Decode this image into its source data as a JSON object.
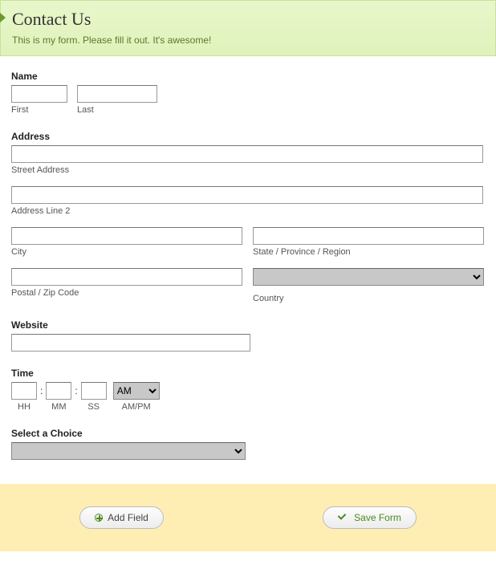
{
  "header": {
    "title": "Contact Us",
    "subtitle": "This is my form. Please fill it out. It's awesome!"
  },
  "name": {
    "label": "Name",
    "first_sub": "First",
    "last_sub": "Last",
    "first_val": "",
    "last_val": ""
  },
  "address": {
    "label": "Address",
    "street_sub": "Street Address",
    "street_val": "",
    "line2_sub": "Address Line 2",
    "line2_val": "",
    "city_sub": "City",
    "city_val": "",
    "state_sub": "State / Province / Region",
    "state_val": "",
    "postal_sub": "Postal / Zip Code",
    "postal_val": "",
    "country_sub": "Country",
    "country_val": ""
  },
  "website": {
    "label": "Website",
    "val": ""
  },
  "time": {
    "label": "Time",
    "hh_sub": "HH",
    "hh_val": "",
    "mm_sub": "MM",
    "mm_val": "",
    "ss_sub": "SS",
    "ss_val": "",
    "ampm_sub": "AM/PM",
    "ampm_val": "AM"
  },
  "choice": {
    "label": "Select a Choice",
    "val": ""
  },
  "footer": {
    "add_label": "Add Field",
    "save_label": "Save Form"
  }
}
